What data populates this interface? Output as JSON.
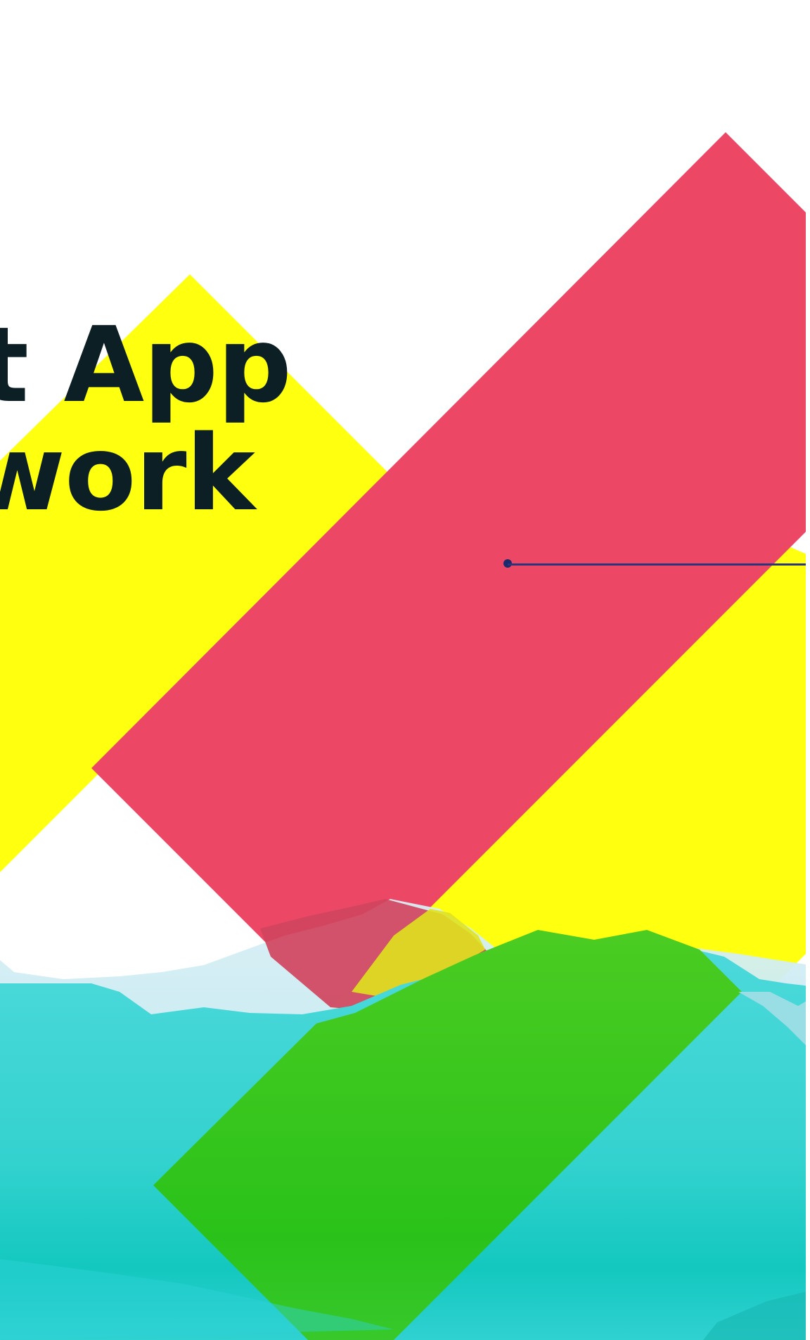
{
  "hero": {
    "title_line_1": "nt App",
    "title_line_2": "work"
  },
  "colors": {
    "background": "#ffffff",
    "headline": "#0c1f24",
    "headline_accent": "#06145f",
    "yellow_shape": "#ffff10",
    "red_shape": "#ec4866",
    "green_shape": "#42cb22",
    "water": "#34d8d2",
    "marker": "#1a2a6c"
  }
}
